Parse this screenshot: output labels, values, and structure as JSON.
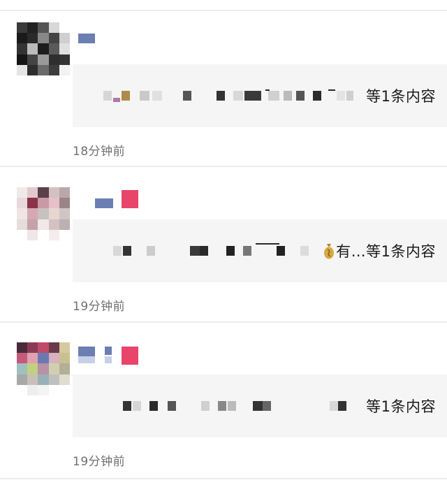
{
  "feed": {
    "items": [
      {
        "summary_text": "等1条内容",
        "time": "18分钟前"
      },
      {
        "summary_prefix": "有…",
        "summary_text": "等1条内容",
        "time": "19分钟前",
        "emoji_icon": "money-bag-icon"
      },
      {
        "summary_text": "等1条内容",
        "time": "19分钟前"
      }
    ]
  },
  "colors": {
    "bubble_background": "#f5f5f5",
    "timestamp_text": "#6f6f6f",
    "summary_text": "#1a1a1a",
    "divider": "#ececec",
    "username_blue": "#6b7fb3",
    "username_pink": "#e8456a"
  }
}
